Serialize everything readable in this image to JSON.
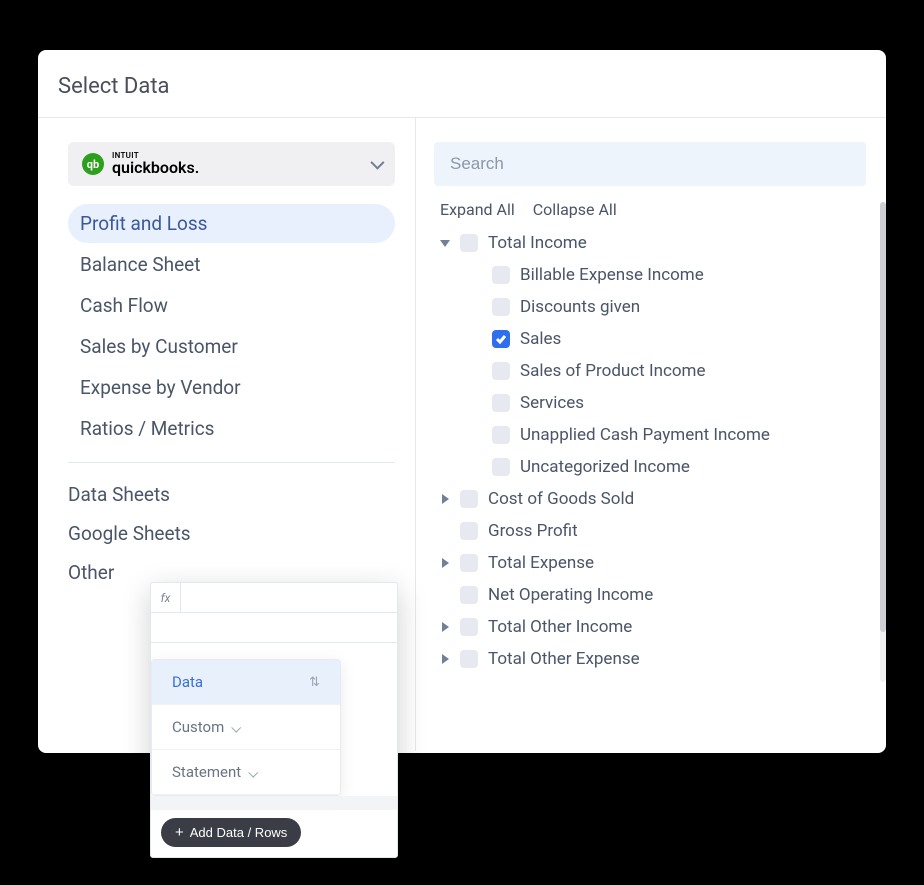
{
  "header": {
    "title": "Select Data"
  },
  "source": {
    "brand_line1": "INTUIT",
    "brand_line2": "quickbooks."
  },
  "reports": [
    {
      "label": "Profit and Loss",
      "active": true
    },
    {
      "label": "Balance Sheet",
      "active": false
    },
    {
      "label": "Cash Flow",
      "active": false
    },
    {
      "label": "Sales by Customer",
      "active": false
    },
    {
      "label": "Expense by Vendor",
      "active": false
    },
    {
      "label": "Ratios / Metrics",
      "active": false
    }
  ],
  "ext_sources": [
    {
      "label": "Data Sheets"
    },
    {
      "label": "Google Sheets"
    },
    {
      "label": "Other"
    }
  ],
  "search": {
    "placeholder": "Search"
  },
  "tree_actions": {
    "expand": "Expand All",
    "collapse": "Collapse All"
  },
  "tree": [
    {
      "label": "Total Income",
      "level": 1,
      "toggle": "open",
      "checked": false
    },
    {
      "label": "Billable Expense Income",
      "level": 2,
      "toggle": null,
      "checked": false
    },
    {
      "label": "Discounts given",
      "level": 2,
      "toggle": null,
      "checked": false
    },
    {
      "label": "Sales",
      "level": 2,
      "toggle": null,
      "checked": true
    },
    {
      "label": "Sales of Product Income",
      "level": 2,
      "toggle": null,
      "checked": false
    },
    {
      "label": "Services",
      "level": 2,
      "toggle": null,
      "checked": false
    },
    {
      "label": "Unapplied Cash Payment Income",
      "level": 2,
      "toggle": null,
      "checked": false
    },
    {
      "label": "Uncategorized Income",
      "level": 2,
      "toggle": null,
      "checked": false
    },
    {
      "label": "Cost of Goods Sold",
      "level": 1,
      "toggle": "closed",
      "checked": false
    },
    {
      "label": "Gross Profit",
      "level": 1,
      "toggle": null,
      "checked": false
    },
    {
      "label": "Total Expense",
      "level": 1,
      "toggle": "closed",
      "checked": false
    },
    {
      "label": "Net Operating Income",
      "level": 1,
      "toggle": null,
      "checked": false
    },
    {
      "label": "Total Other Income",
      "level": 1,
      "toggle": "closed",
      "checked": false
    },
    {
      "label": "Total Other Expense",
      "level": 1,
      "toggle": "closed",
      "checked": false
    }
  ],
  "float": {
    "fx": "fx",
    "menu": [
      {
        "label": "Data",
        "active": true,
        "icon": true,
        "chevron": false
      },
      {
        "label": "Custom",
        "active": false,
        "icon": false,
        "chevron": true
      },
      {
        "label": "Statement",
        "active": false,
        "icon": false,
        "chevron": true
      }
    ],
    "add_button": "Add Data / Rows"
  }
}
